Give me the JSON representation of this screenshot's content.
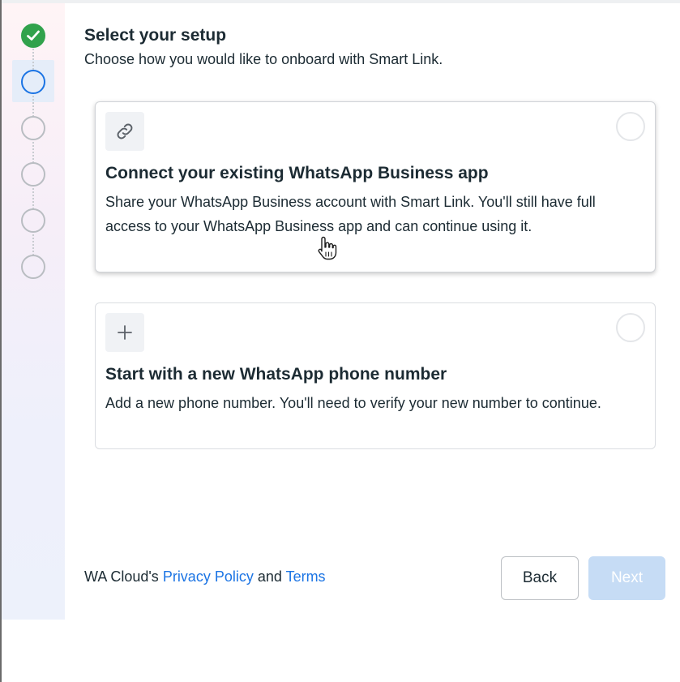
{
  "header": {
    "title": "Select your setup",
    "subtitle": "Choose how you would like to onboard with Smart Link."
  },
  "stepper": {
    "steps": [
      {
        "state": "completed"
      },
      {
        "state": "current"
      },
      {
        "state": "pending"
      },
      {
        "state": "pending"
      },
      {
        "state": "pending"
      },
      {
        "state": "pending"
      }
    ],
    "colors": {
      "completed": "#31a24c",
      "current": "#1b74e4",
      "pending": "#b9bdc2"
    }
  },
  "options": [
    {
      "icon": "link-icon",
      "title": "Connect your existing WhatsApp Business app",
      "description": "Share your WhatsApp Business account with Smart Link. You'll still have full access to your WhatsApp Business app and can continue using it.",
      "selected": false
    },
    {
      "icon": "plus-icon",
      "title": "Start with a new WhatsApp phone number",
      "description": "Add a new phone number. You'll need to verify your new number to continue.",
      "selected": false
    }
  ],
  "footer": {
    "prefix": "WA Cloud's ",
    "privacy_link": "Privacy Policy",
    "joiner": " and ",
    "terms_link": "Terms"
  },
  "buttons": {
    "back_label": "Back",
    "next_label": "Next",
    "next_disabled": true
  },
  "colors": {
    "accent": "#1b74e4",
    "success": "#31a24c",
    "disabled_button": "#c6dcf5"
  }
}
